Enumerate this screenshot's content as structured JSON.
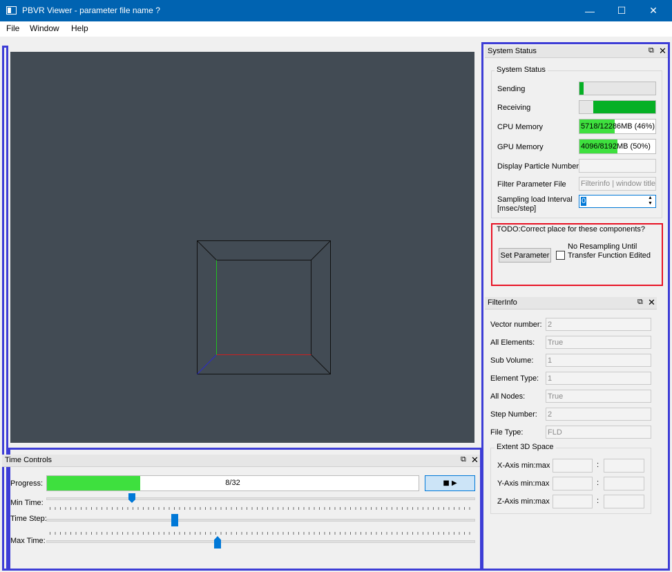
{
  "window": {
    "title": "PBVR Viewer - parameter file name ?",
    "minimize_glyph": "—",
    "maximize_glyph": "☐",
    "close_glyph": "✕"
  },
  "menu": {
    "items": [
      "File",
      "Window",
      "Help"
    ]
  },
  "system_status": {
    "dock_title": "System Status",
    "group_title": "System Status",
    "sending_label": "Sending",
    "sending_progress": 0.05,
    "receiving_label": "Receiving",
    "receiving_progress": 0.82,
    "cpu_label": "CPU Memory",
    "cpu_text": "5718/12286MB (46%)",
    "cpu_progress": 0.46,
    "gpu_label": "GPU Memory",
    "gpu_text": "4096/8192MB (50%)",
    "gpu_progress": 0.5,
    "particle_label": "Display Particle Number",
    "particle_value": "",
    "filter_label": "Filter Parameter File",
    "filter_value": "Filterinfo | window title",
    "sampling_label_1": "Sampling load Interval",
    "sampling_label_2": "[msec/step]",
    "sampling_value": "0",
    "colors": {
      "progress_green": "#06b025",
      "memory_green": "#3ee03e"
    }
  },
  "todo": {
    "title": "TODO:Correct place for these components?",
    "set_parameter": "Set Parameter",
    "checkbox_line1": "No  Resampling Until",
    "checkbox_line2": "Transfer Function  Edited",
    "border_color": "#e81123"
  },
  "filter_info": {
    "dock_title": "FilterInfo",
    "rows": [
      {
        "label": "Vector number:",
        "value": "2"
      },
      {
        "label": "All Elements:",
        "value": "True"
      },
      {
        "label": "Sub  Volume:",
        "value": "1"
      },
      {
        "label": "Element Type:",
        "value": "1"
      },
      {
        "label": "All Nodes:",
        "value": "True"
      },
      {
        "label": "Step Number:",
        "value": "2"
      },
      {
        "label": "File Type:",
        "value": "FLD"
      }
    ],
    "extent_title": "Extent 3D Space",
    "axes": [
      {
        "label": "X-Axis min:max",
        "sep": ":"
      },
      {
        "label": "Y-Axis min:max",
        "sep": ":"
      },
      {
        "label": "Z-Axis min:max",
        "sep": ":"
      }
    ]
  },
  "time_controls": {
    "dock_title": "Time Controls",
    "progress_label": "Progress:",
    "progress_text": "8/32",
    "progress_value": 0.25,
    "play_glyph": "■ ▶",
    "min_time_label": "Min Time:",
    "min_time_pos": 0.2,
    "time_step_label": "Time Step:",
    "time_step_pos": 0.3,
    "max_time_label": "Max Time:",
    "max_time_pos": 0.4
  }
}
